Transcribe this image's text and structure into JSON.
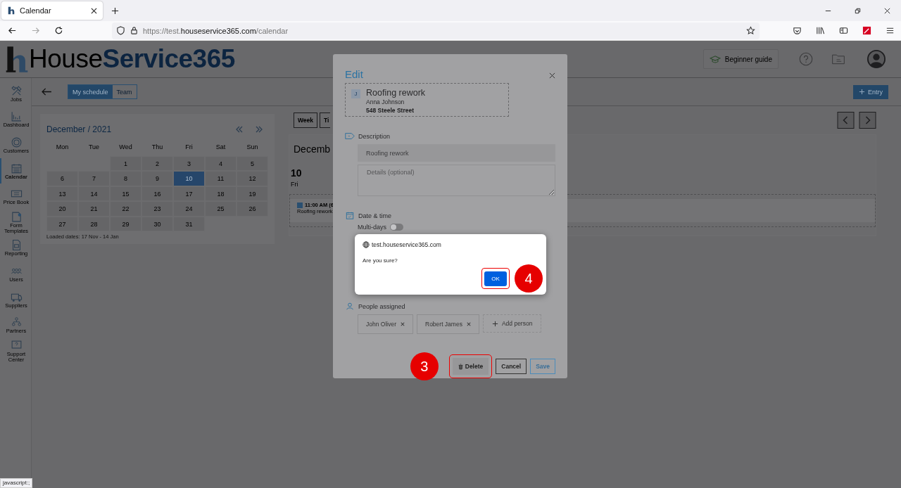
{
  "browser": {
    "tab_title": "Calendar",
    "url_prefix": "https://test.",
    "url_domain": "houseservice365.com",
    "url_path": "/calendar"
  },
  "header": {
    "logo_first": "House",
    "logo_second": "Service365",
    "guide": "Beginner guide"
  },
  "sidebar": {
    "items": [
      {
        "label": "Jobs",
        "kind": "tools",
        "selected": false
      },
      {
        "label": "Dashboard",
        "kind": "chart",
        "selected": false
      },
      {
        "label": "Customers",
        "kind": "target",
        "selected": false
      },
      {
        "label": "Calendar",
        "kind": "calendar",
        "selected": true
      },
      {
        "label": "Price Book",
        "kind": "price",
        "selected": false
      },
      {
        "label": "Form Templates",
        "kind": "form",
        "selected": false
      },
      {
        "label": "Reporting",
        "kind": "report",
        "selected": false
      },
      {
        "label": "Users",
        "kind": "users",
        "selected": false
      },
      {
        "label": "Suppliers",
        "kind": "truck",
        "selected": false
      },
      {
        "label": "Partners",
        "kind": "partners",
        "selected": false
      },
      {
        "label": "Support Center",
        "kind": "help",
        "selected": false
      }
    ]
  },
  "toolbar": {
    "views": [
      {
        "label": "My schedule",
        "selected": true
      },
      {
        "label": "Team",
        "selected": false
      }
    ],
    "entry": "Entry"
  },
  "calendar": {
    "title": "December / 2021",
    "weekdays": [
      "Mon",
      "Tue",
      "Wed",
      "Thu",
      "Fri",
      "Sat",
      "Sun"
    ],
    "weeks": [
      {
        "days": [
          {
            "label": "1",
            "selected": false
          },
          {
            "label": "2",
            "selected": false
          },
          {
            "label": "3",
            "selected": false
          },
          {
            "label": "4",
            "selected": false
          },
          {
            "label": "5",
            "selected": false
          }
        ]
      },
      {
        "days": [
          {
            "label": "6",
            "selected": false
          },
          {
            "label": "7",
            "selected": false
          },
          {
            "label": "8",
            "selected": false
          },
          {
            "label": "9",
            "selected": false
          },
          {
            "label": "10",
            "selected": true
          },
          {
            "label": "11",
            "selected": false
          },
          {
            "label": "12",
            "selected": false
          }
        ]
      },
      {
        "days": [
          {
            "label": "13",
            "selected": false
          },
          {
            "label": "14",
            "selected": false
          },
          {
            "label": "15",
            "selected": false
          },
          {
            "label": "16",
            "selected": false
          },
          {
            "label": "17",
            "selected": false
          },
          {
            "label": "18",
            "selected": false
          },
          {
            "label": "19",
            "selected": false
          }
        ]
      },
      {
        "days": [
          {
            "label": "20",
            "selected": false
          },
          {
            "label": "21",
            "selected": false
          },
          {
            "label": "22",
            "selected": false
          },
          {
            "label": "23",
            "selected": false
          },
          {
            "label": "24",
            "selected": false
          },
          {
            "label": "25",
            "selected": false
          },
          {
            "label": "26",
            "selected": false
          }
        ]
      },
      {
        "days": [
          {
            "label": "27",
            "selected": false
          },
          {
            "label": "28",
            "selected": false
          },
          {
            "label": "29",
            "selected": false
          },
          {
            "label": "30",
            "selected": false
          },
          {
            "label": "31",
            "selected": false
          }
        ]
      }
    ],
    "note": "Loaded dates: 17 Nov - 14 Jan"
  },
  "schedule": {
    "views": [
      "Week",
      "Ti"
    ],
    "heading": "Decemb",
    "day_number": "10",
    "day_name": "Fri",
    "event": {
      "time": "11:00 AM (6",
      "title": "Roofing rework"
    }
  },
  "edit_dialog": {
    "title": "Edit",
    "job": {
      "badge": "J",
      "title": "Roofing rework",
      "customer": "Anna Johnson",
      "address": "548 Steele Street"
    },
    "description_label": "Description",
    "description": "Roofing rework",
    "details_placeholder": "Details (optional)",
    "date_label": "Date & time",
    "multi_days": {
      "label": "Multi-days",
      "on": false
    },
    "people_label": "People assigned",
    "people": [
      "John Oliver",
      "Robert James"
    ],
    "add_person": "Add person",
    "delete": "Delete",
    "cancel": "Cancel",
    "save": "Save",
    "step": "3"
  },
  "confirm": {
    "origin": "test.houseservice365.com",
    "message": "Are you sure?",
    "ok": "OK",
    "step": "4"
  },
  "status_bar": "javascript:;"
}
